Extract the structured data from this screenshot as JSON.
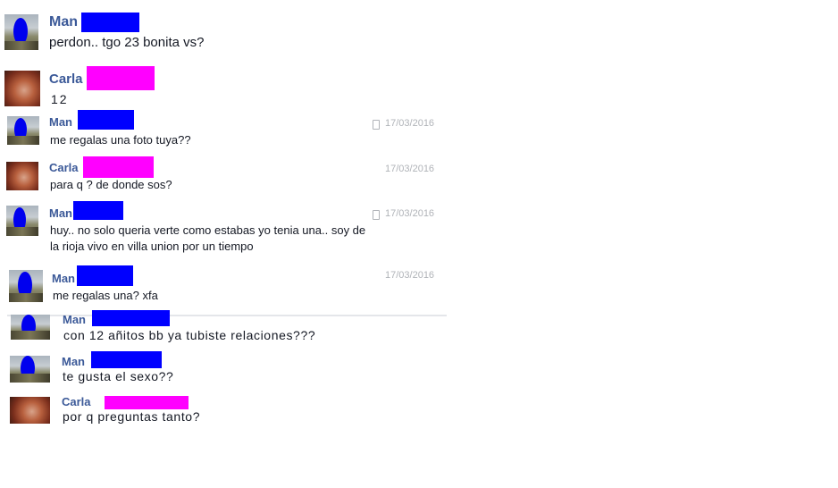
{
  "messages": [
    {
      "sender": "Man",
      "text": "perdon.. tgo 23 bonita vs?",
      "time": ""
    },
    {
      "sender": "Carla",
      "text": "12",
      "time": ""
    },
    {
      "sender": "Man",
      "text": "me regalas una foto tuya??",
      "time": "17/03/2016"
    },
    {
      "sender": "Carla",
      "text": "para q ? de donde sos?",
      "time": "17/03/2016"
    },
    {
      "sender": "Man",
      "text_line1": "huy.. no solo queria verte como estabas yo tenia una.. soy de",
      "text_line2": "la rioja vivo en villa union por un tiempo",
      "time": "17/03/2016"
    },
    {
      "sender": "Man",
      "text": "me regalas una? xfa",
      "time": "17/03/2016"
    },
    {
      "sender": "Man",
      "text": "con 12 añitos bb ya tubiste relaciones???",
      "time": ""
    },
    {
      "sender": "Man",
      "text": "te gusta el sexo??",
      "time": ""
    },
    {
      "sender": "Carla",
      "text": "por q preguntas tanto?",
      "time": ""
    }
  ]
}
